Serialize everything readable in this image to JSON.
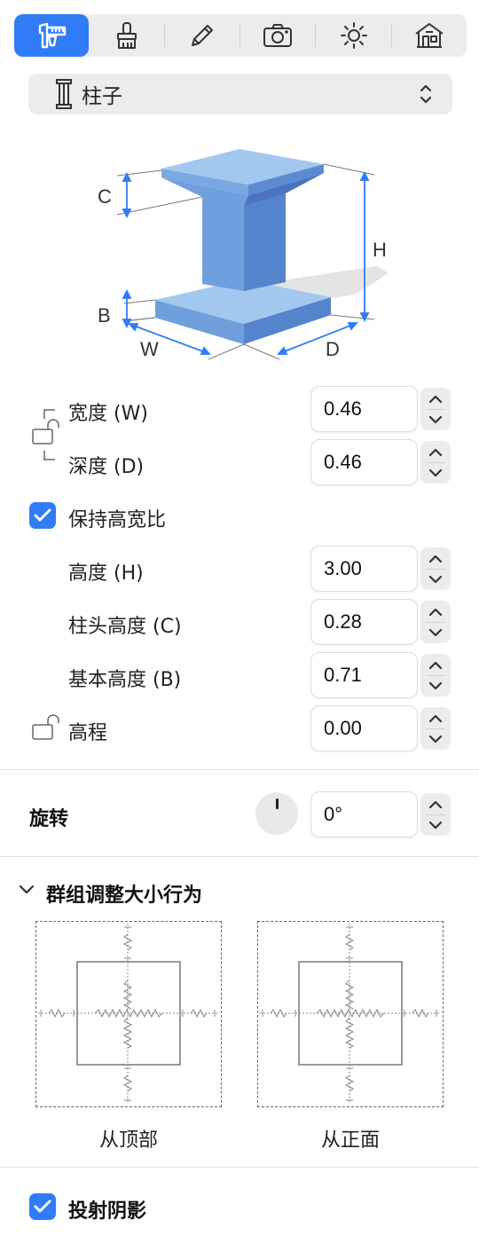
{
  "toolbar": {
    "tabs": [
      {
        "icon": "measure-caliper-icon",
        "active": true
      },
      {
        "icon": "paint-brush-icon",
        "active": false
      },
      {
        "icon": "pencil-icon",
        "active": false
      },
      {
        "icon": "camera-icon",
        "active": false
      },
      {
        "icon": "sun-icon",
        "active": false
      },
      {
        "icon": "house-icon",
        "active": false
      }
    ],
    "accent_color": "#2f7cf6"
  },
  "object_type": {
    "label": "柱子",
    "icon": "column-icon"
  },
  "diagram": {
    "labels": {
      "c": "C",
      "h": "H",
      "b": "B",
      "w": "W",
      "d": "D"
    },
    "colors": {
      "top": "#a3c8f0",
      "front": "#6f9fdc",
      "side": "#5484cc"
    }
  },
  "dimensions": {
    "width": {
      "label": "宽度 (W)",
      "value": "0.46"
    },
    "depth": {
      "label": "深度 (D)",
      "value": "0.46"
    },
    "keep_ratio": {
      "label": "保持高宽比",
      "checked": true
    },
    "height": {
      "label": "高度 (H)",
      "value": "3.00"
    },
    "capital_height": {
      "label": "柱头高度 (C)",
      "value": "0.28"
    },
    "base_height": {
      "label": "基本高度 (B)",
      "value": "0.71"
    },
    "elevation": {
      "label": "高程",
      "value": "0.00"
    }
  },
  "rotation": {
    "label": "旋转",
    "value": "0°"
  },
  "group_resize": {
    "title": "群组调整大小行为",
    "from_top": "从顶部",
    "from_front": "从正面"
  },
  "cast_shadow": {
    "label": "投射阴影",
    "checked": true
  }
}
